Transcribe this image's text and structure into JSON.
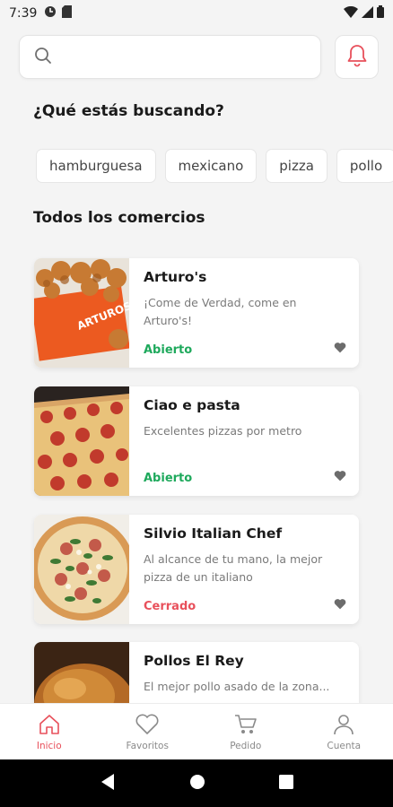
{
  "status_bar": {
    "time": "7:39"
  },
  "search": {
    "placeholder": "",
    "value": ""
  },
  "sections": {
    "looking_for": "¿Qué estás buscando?",
    "all_stores": "Todos los comercios"
  },
  "categories": [
    "hamburguesa",
    "mexicano",
    "pizza",
    "pollo"
  ],
  "stores": [
    {
      "name": "Arturo's",
      "description": "¡Come de Verdad, come en Arturo's!",
      "status": "Abierto",
      "status_color": "#1ea95c"
    },
    {
      "name": "Ciao e pasta",
      "description": "Excelentes pizzas por metro",
      "status": "Abierto",
      "status_color": "#1ea95c"
    },
    {
      "name": "Silvio Italian Chef",
      "description": "Al alcance de tu mano, la mejor pizza de un italiano",
      "status": "Cerrado",
      "status_color": "#e8505b"
    },
    {
      "name": "Pollos El Rey",
      "description": "El mejor pollo asado de la zona...",
      "status": "",
      "status_color": "#1ea95c"
    }
  ],
  "thumb_logo_text": "ARTUROS",
  "bottom_nav": [
    {
      "label": "Inicio",
      "icon": "home-icon",
      "active": true
    },
    {
      "label": "Favoritos",
      "icon": "heart-icon",
      "active": false
    },
    {
      "label": "Pedido",
      "icon": "cart-icon",
      "active": false
    },
    {
      "label": "Cuenta",
      "icon": "user-icon",
      "active": false
    }
  ],
  "colors": {
    "accent": "#e8505b",
    "open": "#1ea95c",
    "closed": "#e8505b"
  }
}
